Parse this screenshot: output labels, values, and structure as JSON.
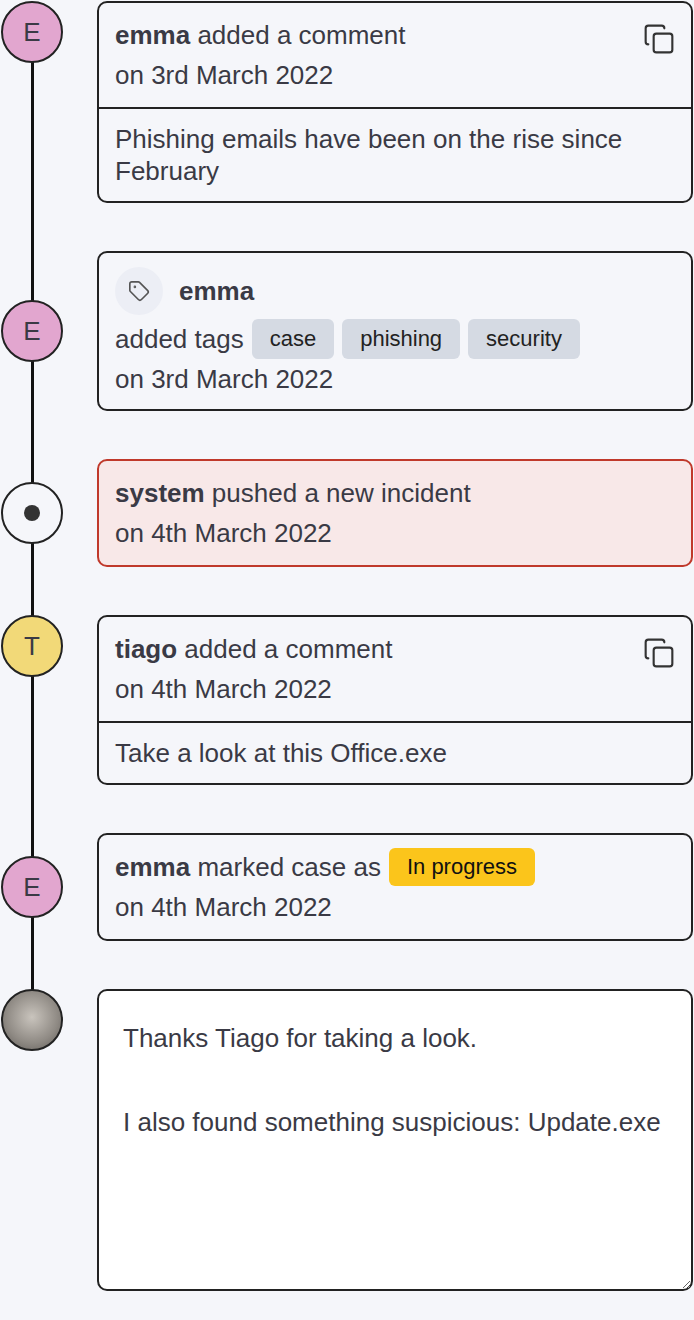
{
  "timeline": [
    {
      "kind": "comment",
      "avatar": "E",
      "avatar_color": "#e2a6cf",
      "author": "emma",
      "action": "added a comment",
      "date": "on 3rd March 2022",
      "body": "Phishing emails have been on the rise since February"
    },
    {
      "kind": "tags",
      "avatar": "E",
      "avatar_color": "#e2a6cf",
      "author": "emma",
      "action": "added tags",
      "tags": [
        "case",
        "phishing",
        "security"
      ],
      "date": "on 3rd March 2022"
    },
    {
      "kind": "incident",
      "author": "system",
      "action": "pushed a new incident",
      "date": "on 4th March 2022"
    },
    {
      "kind": "comment",
      "avatar": "T",
      "avatar_color": "#f2d978",
      "author": "tiago",
      "action": "added a comment",
      "date": "on 4th March 2022",
      "body": "Take a look at this Office.exe"
    },
    {
      "kind": "status",
      "avatar": "E",
      "avatar_color": "#e2a6cf",
      "author": "emma",
      "action": "marked case as",
      "status": {
        "label": "In progress",
        "color": "#fbc51b"
      },
      "date": "on 4th March 2022"
    }
  ],
  "composer": {
    "text": "Thanks Tiago for taking a look.\n\nI also found something suspicious: Update.exe"
  }
}
